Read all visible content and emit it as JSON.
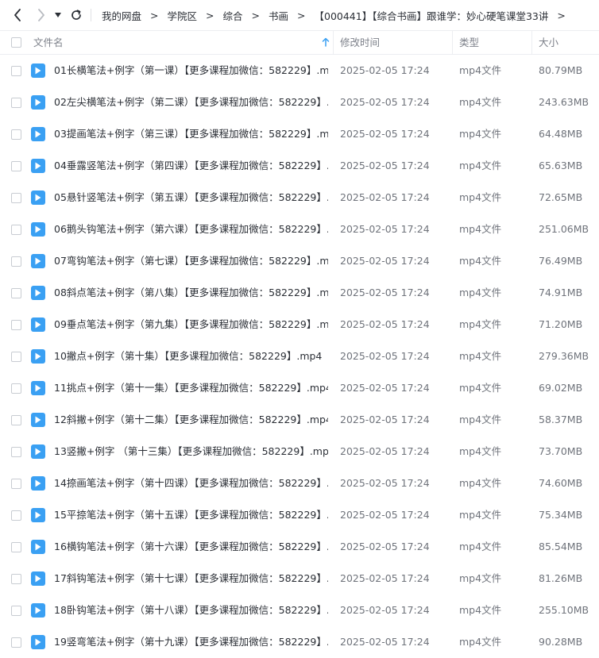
{
  "nav": {
    "back_icon": "chevron-left-icon",
    "forward_icon": "chevron-right-icon",
    "history_icon": "caret-down-icon",
    "refresh_icon": "refresh-icon"
  },
  "breadcrumb": [
    "我的网盘",
    "学院区",
    "综合",
    "书画",
    "【000441】【综合书画】跟谁学：妙心硬笔课堂33讲"
  ],
  "breadcrumb_separator": ">",
  "trailing_separator": ">",
  "columns": {
    "name": "文件名",
    "modified": "修改时间",
    "type": "类型",
    "size": "大小"
  },
  "colors": {
    "file_icon": "#3aa0f3",
    "sort_arrow": "#3aa0f3"
  },
  "files": [
    {
      "name": "01长横笔法+例字（第一课）【更多课程加微信：582229】.m...",
      "modified": "2025-02-05 17:24",
      "type": "mp4文件",
      "size": "80.79MB"
    },
    {
      "name": "02左尖横笔法+例字（第二课）【更多课程加微信：582229】...",
      "modified": "2025-02-05 17:24",
      "type": "mp4文件",
      "size": "243.63MB"
    },
    {
      "name": "03提画笔法+例字（第三课）【更多课程加微信：582229】.m...",
      "modified": "2025-02-05 17:24",
      "type": "mp4文件",
      "size": "64.48MB"
    },
    {
      "name": "04垂露竖笔法+例字（第四课）【更多课程加微信：582229】...",
      "modified": "2025-02-05 17:24",
      "type": "mp4文件",
      "size": "65.63MB"
    },
    {
      "name": "05悬针竖笔法+例字（第五课）【更多课程加微信：582229】...",
      "modified": "2025-02-05 17:24",
      "type": "mp4文件",
      "size": "72.65MB"
    },
    {
      "name": "06鹅头钩笔法+例字（第六课）【更多课程加微信：582229】...",
      "modified": "2025-02-05 17:24",
      "type": "mp4文件",
      "size": "251.06MB"
    },
    {
      "name": "07弯钩笔法+例字（第七课）【更多课程加微信：582229】.m...",
      "modified": "2025-02-05 17:24",
      "type": "mp4文件",
      "size": "76.49MB"
    },
    {
      "name": "08斜点笔法+例字（第八集）【更多课程加微信：582229】.m...",
      "modified": "2025-02-05 17:24",
      "type": "mp4文件",
      "size": "74.91MB"
    },
    {
      "name": "09垂点笔法+例字（第九集）【更多课程加微信：582229】.m...",
      "modified": "2025-02-05 17:24",
      "type": "mp4文件",
      "size": "71.20MB"
    },
    {
      "name": "10撇点+例字（第十集）【更多课程加微信：582229】.mp4",
      "modified": "2025-02-05 17:24",
      "type": "mp4文件",
      "size": "279.36MB"
    },
    {
      "name": "11挑点+例字（第十一集）【更多课程加微信：582229】.mp4",
      "modified": "2025-02-05 17:24",
      "type": "mp4文件",
      "size": "69.02MB"
    },
    {
      "name": "12斜撇+例字（第十二集）【更多课程加微信：582229】.mp4",
      "modified": "2025-02-05 17:24",
      "type": "mp4文件",
      "size": "58.37MB"
    },
    {
      "name": "13竖撇+例字 （第十三集）【更多课程加微信：582229】.mp4",
      "modified": "2025-02-05 17:24",
      "type": "mp4文件",
      "size": "73.70MB"
    },
    {
      "name": "14捺画笔法+例字（第十四课）【更多课程加微信：582229】...",
      "modified": "2025-02-05 17:24",
      "type": "mp4文件",
      "size": "74.60MB"
    },
    {
      "name": "15平捺笔法+例字（第十五课）【更多课程加微信：582229】...",
      "modified": "2025-02-05 17:24",
      "type": "mp4文件",
      "size": "75.34MB"
    },
    {
      "name": "16横钩笔法+例字（第十六课）【更多课程加微信：582229】...",
      "modified": "2025-02-05 17:24",
      "type": "mp4文件",
      "size": "85.54MB"
    },
    {
      "name": "17斜钩笔法+例字（第十七课）【更多课程加微信：582229】...",
      "modified": "2025-02-05 17:24",
      "type": "mp4文件",
      "size": "81.26MB"
    },
    {
      "name": "18卧钩笔法+例字（第十八课）【更多课程加微信：582229】...",
      "modified": "2025-02-05 17:24",
      "type": "mp4文件",
      "size": "255.10MB"
    },
    {
      "name": "19竖弯笔法+例字（第十九课）【更多课程加微信：582229】...",
      "modified": "2025-02-05 17:24",
      "type": "mp4文件",
      "size": "90.28MB"
    }
  ]
}
